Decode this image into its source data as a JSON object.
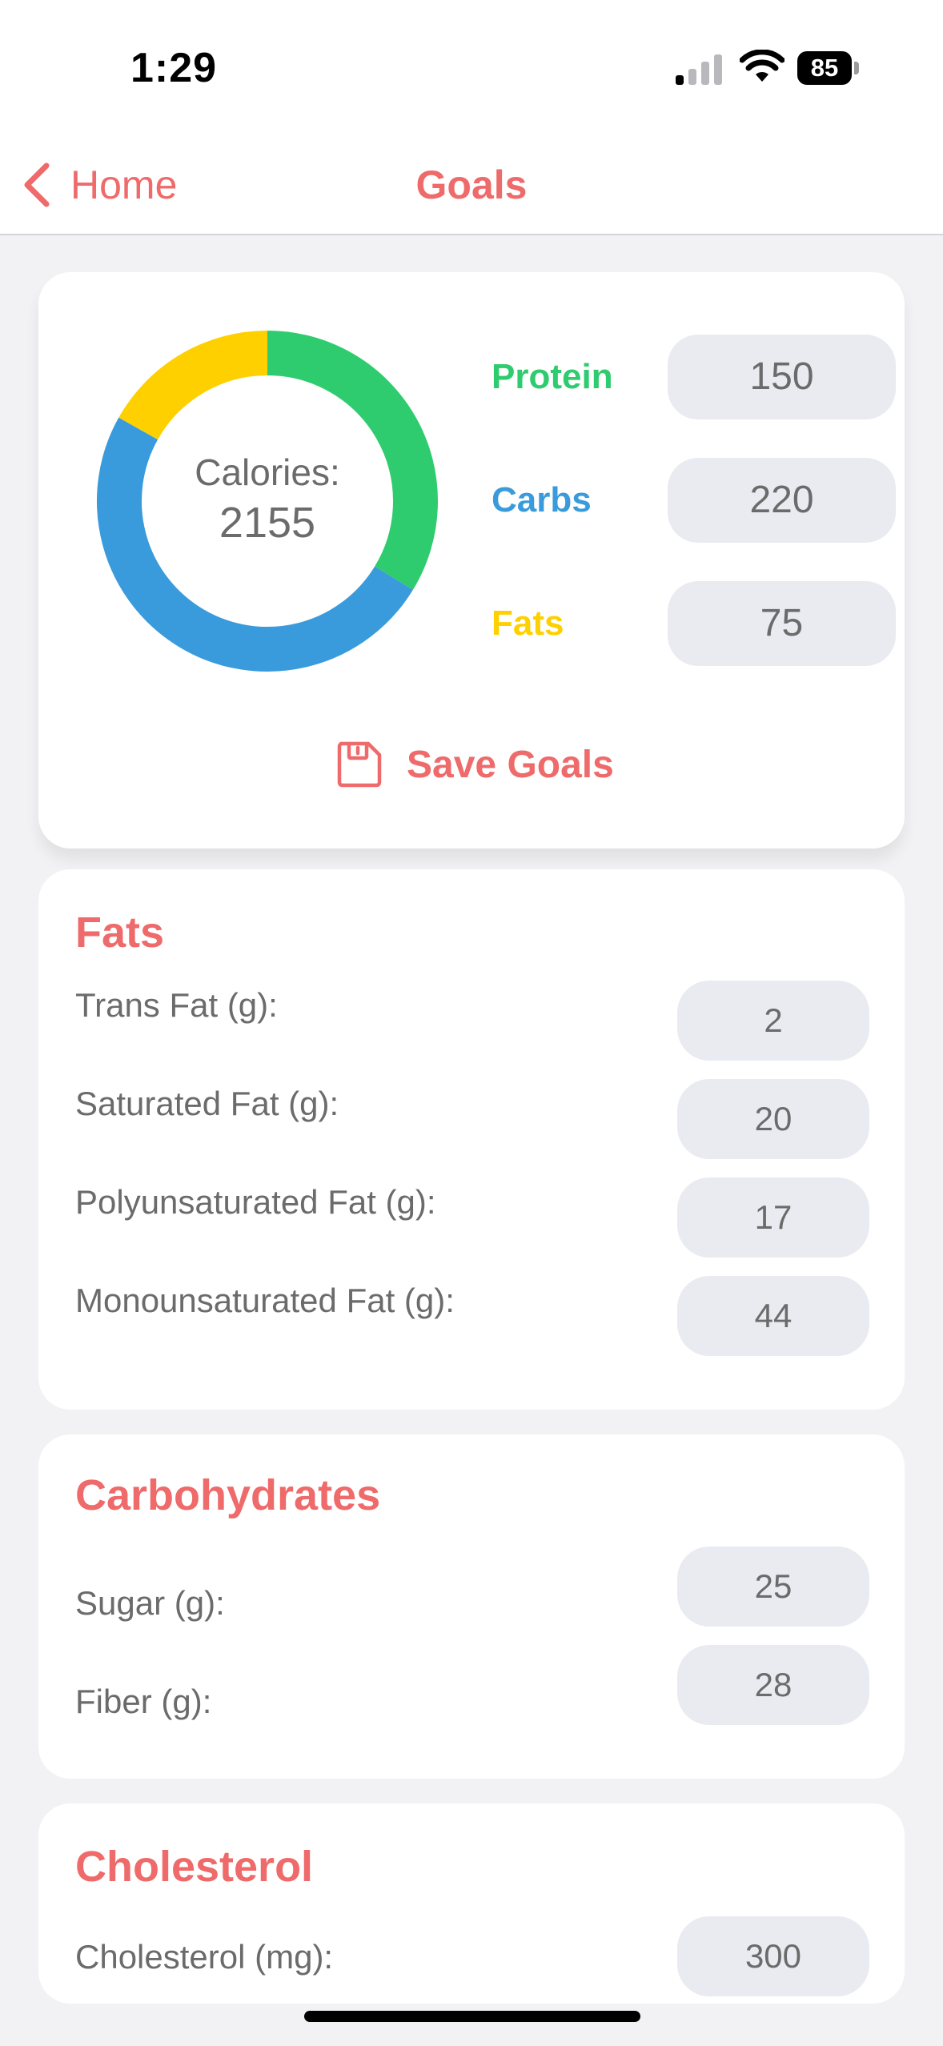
{
  "status_bar": {
    "time": "1:29",
    "battery": "85",
    "icons": [
      "signal-icon",
      "wifi-icon",
      "battery-icon"
    ]
  },
  "nav": {
    "back_label": "Home",
    "title": "Goals",
    "back_icon": "chevron-left-icon"
  },
  "macros": {
    "calories_label": "Calories:",
    "calories_value": "2155",
    "protein": {
      "label": "Protein",
      "value": "150",
      "color": "#2ecc6e"
    },
    "carbs": {
      "label": "Carbs",
      "value": "220",
      "color": "#3a9bdc"
    },
    "fats": {
      "label": "Fats",
      "value": "75",
      "color": "#ffd000"
    },
    "save_label": "Save Goals",
    "save_icon": "save-icon"
  },
  "fats_section": {
    "title": "Fats",
    "rows": [
      {
        "label": "Trans Fat (g):",
        "value": "2"
      },
      {
        "label": "Saturated Fat (g):",
        "value": "20"
      },
      {
        "label": "Polyunsaturated Fat (g):",
        "value": "17"
      },
      {
        "label": "Monounsaturated Fat (g):",
        "value": "44"
      }
    ]
  },
  "carbs_section": {
    "title": "Carbohydrates",
    "rows": [
      {
        "label": "Sugar (g):",
        "value": "25"
      },
      {
        "label": "Fiber (g):",
        "value": "28"
      }
    ]
  },
  "cholesterol_section": {
    "title": "Cholesterol",
    "rows": [
      {
        "label": "Cholesterol (mg):",
        "value": "300"
      }
    ]
  },
  "colors": {
    "accent": "#ef6a6a",
    "input_bg": "#e9ebf1",
    "page_bg": "#f2f2f4"
  }
}
